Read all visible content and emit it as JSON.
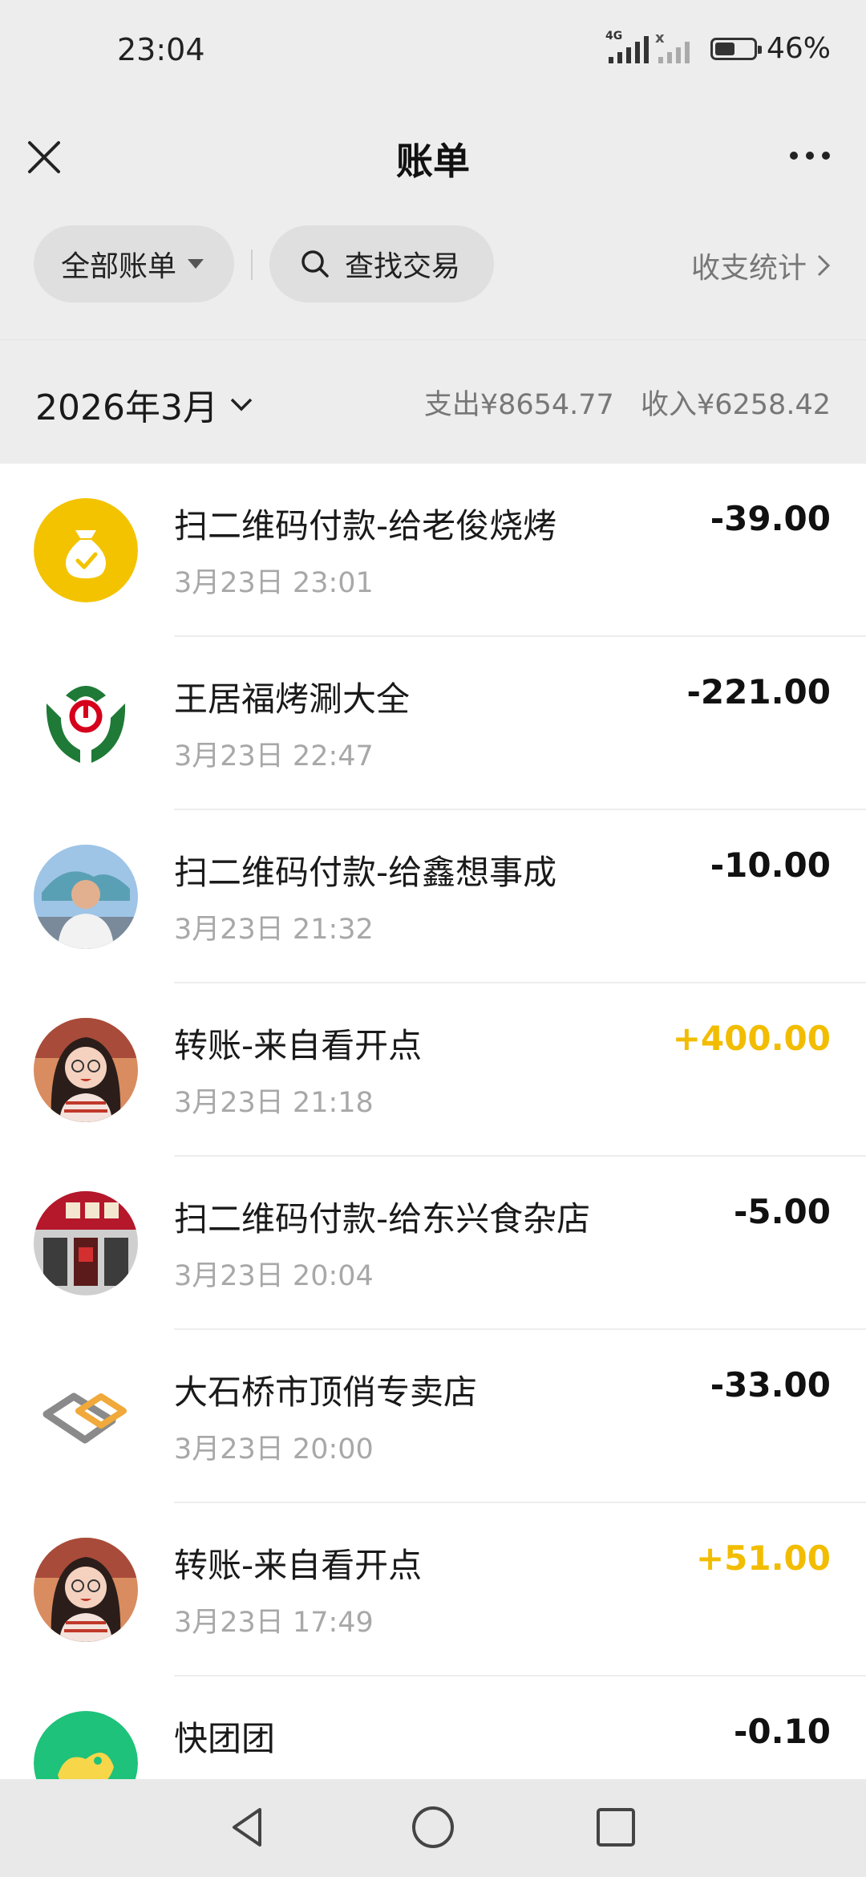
{
  "status_bar": {
    "time": "23:04",
    "signal1_label": "4G",
    "signal2_label": "x",
    "battery_percent": "46%",
    "battery_level": 0.46
  },
  "header": {
    "title": "账单",
    "close_icon": "close-icon",
    "more_icon": "more-icon"
  },
  "filters": {
    "all_bills": "全部账单",
    "search": "查找交易",
    "stats": "收支统计"
  },
  "month": {
    "label": "2026年3月",
    "expense": "支出¥8654.77",
    "income": "收入¥6258.42"
  },
  "transactions": [
    {
      "title": "扫二维码付款-给老俊烧烤",
      "time": "3月23日 23:01",
      "amount": "-39.00",
      "type": "expense",
      "avatar": "money-bag-icon"
    },
    {
      "title": "王居福烤涮大全",
      "time": "3月23日 22:47",
      "amount": "-221.00",
      "type": "expense",
      "avatar": "bank-logo"
    },
    {
      "title": "扫二维码付款-给鑫想事成",
      "time": "3月23日 21:32",
      "amount": "-10.00",
      "type": "expense",
      "avatar": "user-photo"
    },
    {
      "title": "转账-来自看开点",
      "time": "3月23日 21:18",
      "amount": "+400.00",
      "type": "income",
      "avatar": "cartoon-avatar"
    },
    {
      "title": "扫二维码付款-给东兴食杂店",
      "time": "3月23日 20:04",
      "amount": "-5.00",
      "type": "expense",
      "avatar": "shop-photo"
    },
    {
      "title": "大石桥市顶俏专卖店",
      "time": "3月23日 20:00",
      "amount": "-33.00",
      "type": "expense",
      "avatar": "brand-logo"
    },
    {
      "title": "转账-来自看开点",
      "time": "3月23日 17:49",
      "amount": "+51.00",
      "type": "income",
      "avatar": "cartoon-avatar"
    },
    {
      "title": "快团团",
      "time": "",
      "amount": "-0.10",
      "type": "expense",
      "avatar": "app-logo"
    }
  ],
  "colors": {
    "background": "#ededed",
    "income": "#f2bd00",
    "expense": "#111111",
    "wechat_green": "#07c160"
  },
  "nav": {
    "back_icon": "back-triangle-icon",
    "home_icon": "home-circle-icon",
    "recents_icon": "recents-square-icon"
  }
}
